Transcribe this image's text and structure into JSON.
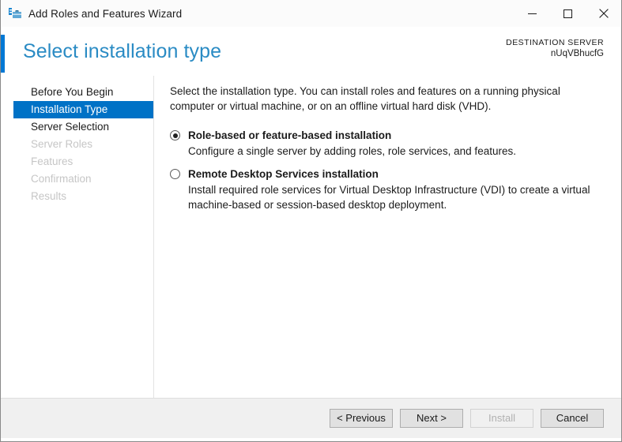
{
  "window": {
    "title": "Add Roles and Features Wizard",
    "icon": "wizard-toolbox-icon",
    "controls": {
      "minimize": "minimize-icon",
      "maximize": "maximize-icon",
      "close": "close-icon"
    }
  },
  "header": {
    "page_title": "Select installation type",
    "destination_label": "DESTINATION SERVER",
    "destination_server": "nUqVBhucfG",
    "accent_color": "#0078d4",
    "title_color": "#2a8bc4"
  },
  "nav": {
    "items": [
      {
        "label": "Before You Begin",
        "state": "normal"
      },
      {
        "label": "Installation Type",
        "state": "selected"
      },
      {
        "label": "Server Selection",
        "state": "normal"
      },
      {
        "label": "Server Roles",
        "state": "disabled"
      },
      {
        "label": "Features",
        "state": "disabled"
      },
      {
        "label": "Confirmation",
        "state": "disabled"
      },
      {
        "label": "Results",
        "state": "disabled"
      }
    ],
    "selected_color": "#0072c6"
  },
  "content": {
    "intro": "Select the installation type. You can install roles and features on a running physical computer or virtual machine, or on an offline virtual hard disk (VHD).",
    "options": [
      {
        "label": "Role-based or feature-based installation",
        "description": "Configure a single server by adding roles, role services, and features.",
        "selected": true
      },
      {
        "label": "Remote Desktop Services installation",
        "description": "Install required role services for Virtual Desktop Infrastructure (VDI) to create a virtual machine-based or session-based desktop deployment.",
        "selected": false
      }
    ]
  },
  "footer": {
    "previous_label": "< Previous",
    "next_label": "Next >",
    "install_label": "Install",
    "cancel_label": "Cancel",
    "install_enabled": false
  }
}
